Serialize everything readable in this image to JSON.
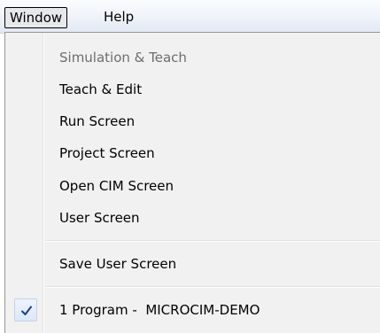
{
  "menubar": {
    "window_label": "Window",
    "help_label": "Help"
  },
  "window_menu": {
    "items": [
      {
        "label": "Simulation & Teach",
        "enabled": false
      },
      {
        "label": "Teach & Edit",
        "enabled": true
      },
      {
        "label": "Run Screen",
        "enabled": true
      },
      {
        "label": "Project Screen",
        "enabled": true
      },
      {
        "label": "Open CIM Screen",
        "enabled": true
      },
      {
        "label": "User Screen",
        "enabled": true
      }
    ],
    "save_user_screen": "Save User Screen",
    "windows": [
      {
        "label": "1 Program -  MICROCIM-DEMO",
        "checked": true
      }
    ]
  },
  "icons": {
    "check": "checkmark-icon"
  },
  "colors": {
    "menu_background": "#f1f1f1",
    "disabled_text": "#6d6d6d",
    "check_color": "#1a3f8f"
  }
}
